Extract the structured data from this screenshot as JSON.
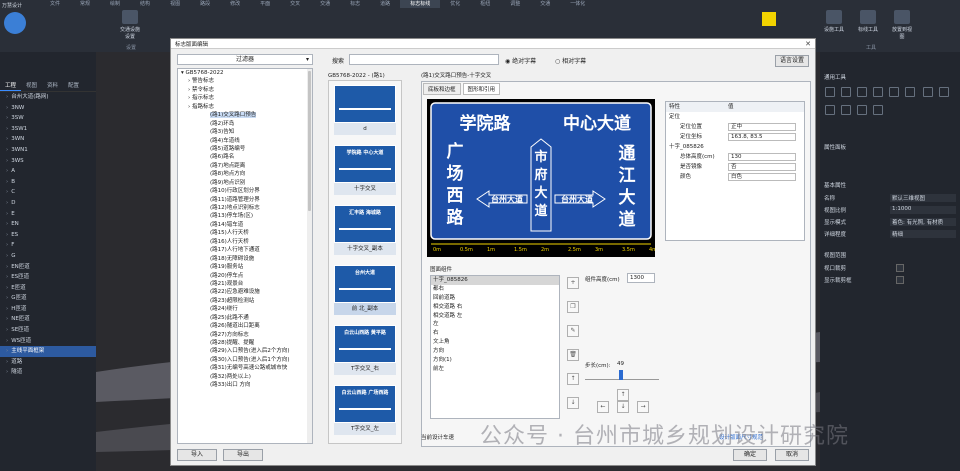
{
  "app": {
    "title": "万慧设计",
    "ribbon_tabs": [
      "文件",
      "常规",
      "绘制",
      "结构",
      "视图",
      "路段",
      "修改",
      "平面",
      "交叉",
      "交通",
      "标志",
      "道路",
      "标志标线",
      "优化",
      "枢纽",
      "调整",
      "交通",
      "一体化"
    ],
    "active_tab": "标志标线"
  },
  "ribbon": {
    "buttons": [
      "交通设施设置",
      "设置",
      "设施工具",
      "标线工具",
      "放置到视图"
    ],
    "groups": {
      "settings": "设置",
      "tools": "工具"
    }
  },
  "left_panel": {
    "tabs": [
      "工程",
      "视图",
      "资料",
      "配置"
    ],
    "active_tab": "工程",
    "items": [
      "台州大道(路网)",
      "3NW",
      "3SW",
      "3SW1",
      "3WN",
      "3WN1",
      "3WS",
      "A",
      "B",
      "C",
      "D",
      "E",
      "EN",
      "ES",
      "F",
      "G",
      "EN匝道",
      "ES匝道",
      "E匝道",
      "G匝道",
      "H匝道",
      "NE匝道",
      "SE匝道",
      "WS匝道",
      "主线平面框架",
      "道路",
      "隧道"
    ],
    "selected": "主线平面框架"
  },
  "right_panel": {
    "section_tools": "通用工具",
    "section_props": "属性面板",
    "section_basic": "基本属性",
    "props": [
      {
        "k": "名称",
        "v": "默认三维视图"
      },
      {
        "k": "视图比例",
        "v": "1:1000"
      },
      {
        "k": "显示模式",
        "v": "着色: 有光照, 有材质"
      },
      {
        "k": "详细程度",
        "v": "精细"
      }
    ],
    "section_range": "视图范围",
    "checks": [
      "视口裁剪",
      "显示裁剪框"
    ]
  },
  "dialog": {
    "title": "标志版面编辑",
    "filter_label": "过滤器",
    "search_label": "搜索",
    "radio_abs": "绝对字幕",
    "radio_rel": "相对字幕",
    "lang_btn": "语言设置",
    "crumb": "GB5768-2022 - (路1)",
    "crumb2": "(路1)交叉路口预告-十字交叉",
    "tab1": "底板和边框",
    "tab2": "图形和引用",
    "import_btn": "导入",
    "export_btn": "导出",
    "confirm_btn": "确定",
    "cancel_btn": "取消",
    "current_label": "当前设计车速",
    "status_text": "设计版面尺寸规范",
    "tree": [
      {
        "lvl": 0,
        "t": "GB5768-2022"
      },
      {
        "lvl": 1,
        "t": "警告标志"
      },
      {
        "lvl": 1,
        "t": "禁令标志"
      },
      {
        "lvl": 1,
        "t": "指示标志"
      },
      {
        "lvl": 1,
        "t": "指路标志"
      },
      {
        "lvl": 2,
        "t": "(路1)交叉路口预告",
        "sel": true
      },
      {
        "lvl": 2,
        "t": "(路2)环岛"
      },
      {
        "lvl": 2,
        "t": "(路3)告知"
      },
      {
        "lvl": 2,
        "t": "(路4)车道线"
      },
      {
        "lvl": 2,
        "t": "(路5)道路编号"
      },
      {
        "lvl": 2,
        "t": "(路6)路名"
      },
      {
        "lvl": 2,
        "t": "(路7)地点距离"
      },
      {
        "lvl": 2,
        "t": "(路8)地点方向"
      },
      {
        "lvl": 2,
        "t": "(路9)地点识别"
      },
      {
        "lvl": 2,
        "t": "(路10)行政区划分界"
      },
      {
        "lvl": 2,
        "t": "(路11)道路管理分界"
      },
      {
        "lvl": 2,
        "t": "(路12)地点识别标志"
      },
      {
        "lvl": 2,
        "t": "(路13)停车场(区)"
      },
      {
        "lvl": 2,
        "t": "(路14)错车道"
      },
      {
        "lvl": 2,
        "t": "(路15)人行天桥"
      },
      {
        "lvl": 2,
        "t": "(路16)人行天桥"
      },
      {
        "lvl": 2,
        "t": "(路17)人行地下通道"
      },
      {
        "lvl": 2,
        "t": "(路18)无障碍设施"
      },
      {
        "lvl": 2,
        "t": "(路19)服务站"
      },
      {
        "lvl": 2,
        "t": "(路20)停车点"
      },
      {
        "lvl": 2,
        "t": "(路21)观景台"
      },
      {
        "lvl": 2,
        "t": "(路22)应急避难设施"
      },
      {
        "lvl": 2,
        "t": "(路23)超限检测站"
      },
      {
        "lvl": 2,
        "t": "(路24)绕行"
      },
      {
        "lvl": 2,
        "t": "(路25)此路不通"
      },
      {
        "lvl": 2,
        "t": "(路26)隧道出口距离"
      },
      {
        "lvl": 2,
        "t": "(路27)方向标志"
      },
      {
        "lvl": 2,
        "t": "(路28)提醒、提醒"
      },
      {
        "lvl": 2,
        "t": "(路29)入口预告(进入后2个方向)"
      },
      {
        "lvl": 2,
        "t": "(路30)入口预告(进入后1个方向)"
      },
      {
        "lvl": 2,
        "t": "(路31)无编号高速公路或城市快"
      },
      {
        "lvl": 2,
        "t": "(路32)两处以上)"
      },
      {
        "lvl": 2,
        "t": "(路33)出口 方向"
      }
    ],
    "thumbs": [
      {
        "cap": "d",
        "t": ""
      },
      {
        "cap": "十字交叉",
        "t": "学院路  中心大道"
      },
      {
        "cap": "十字交叉_副本",
        "t": "汇丰路  海城路"
      },
      {
        "cap": "前 北_副本",
        "t": "台州大道",
        "sel": true
      },
      {
        "cap": "T字交叉_右",
        "t": "白云山西路 黄平路"
      },
      {
        "cap": "T字交叉_左",
        "t": "白云山西路 广场西路"
      }
    ],
    "sign": {
      "top_left": "学院路",
      "top_right": "中心大道",
      "left": [
        "广",
        "场",
        "西",
        "路"
      ],
      "center": [
        "市",
        "府",
        "大",
        "道"
      ],
      "right": [
        "通",
        "江",
        "大",
        "道"
      ],
      "arrow_left": "台州大道",
      "arrow_right": "台州大道",
      "bg": "#1f4fa8",
      "ruler": [
        "0m",
        "0.5m",
        "1m",
        "1.5m",
        "2m",
        "2.5m",
        "3m",
        "3.5m",
        "4m"
      ]
    },
    "props_header": {
      "k": "特性",
      "v": "值"
    },
    "props": [
      {
        "k": "定位",
        "v": "",
        "group": true
      },
      {
        "k": "定位位置",
        "v": "正中",
        "in": true
      },
      {
        "k": "定位坐标",
        "v": "163.8, 83.5",
        "in": true
      },
      {
        "k": "十字_085826",
        "v": "",
        "group": true
      },
      {
        "k": "总体高度(cm)",
        "v": "130",
        "in": true
      },
      {
        "k": "是否镜像",
        "v": "否",
        "in": true
      },
      {
        "k": "颜色",
        "v": "白色",
        "in": true
      }
    ],
    "comp_label": "图面组件",
    "comp_list": [
      "十字_085826",
      "都右",
      "回前道路",
      "相交道路 右",
      "相交道路 左",
      "左",
      "右",
      "文上角",
      "方向",
      "方向(1)",
      "前左"
    ],
    "comp_height_label": "组件高度(cm)",
    "comp_height": "1300",
    "step_label": "步长(cm):",
    "step_value": "49"
  },
  "watermark": "公众号 · 台州市城乡规划设计研究院"
}
